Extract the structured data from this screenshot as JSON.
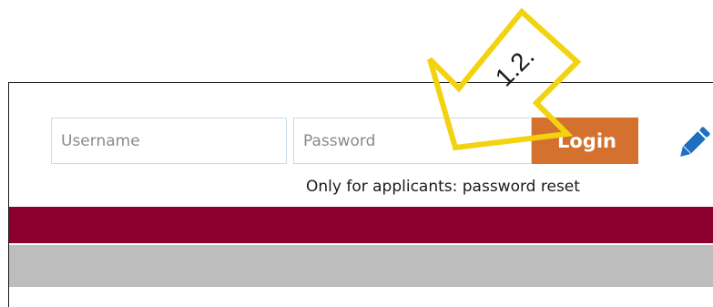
{
  "login": {
    "username_placeholder": "Username",
    "password_placeholder": "Password",
    "login_label": "Login",
    "reset_link": "Only for applicants: password reset"
  },
  "annotation": {
    "step_label": "1.2."
  },
  "colors": {
    "login_button": "#d4712f",
    "header_band": "#8c0030",
    "subheader_band": "#bdbdbd",
    "edit_icon": "#1f6fc1",
    "callout_arrow": "#f3d20f"
  },
  "icons": {
    "edit": "pencil-icon"
  }
}
